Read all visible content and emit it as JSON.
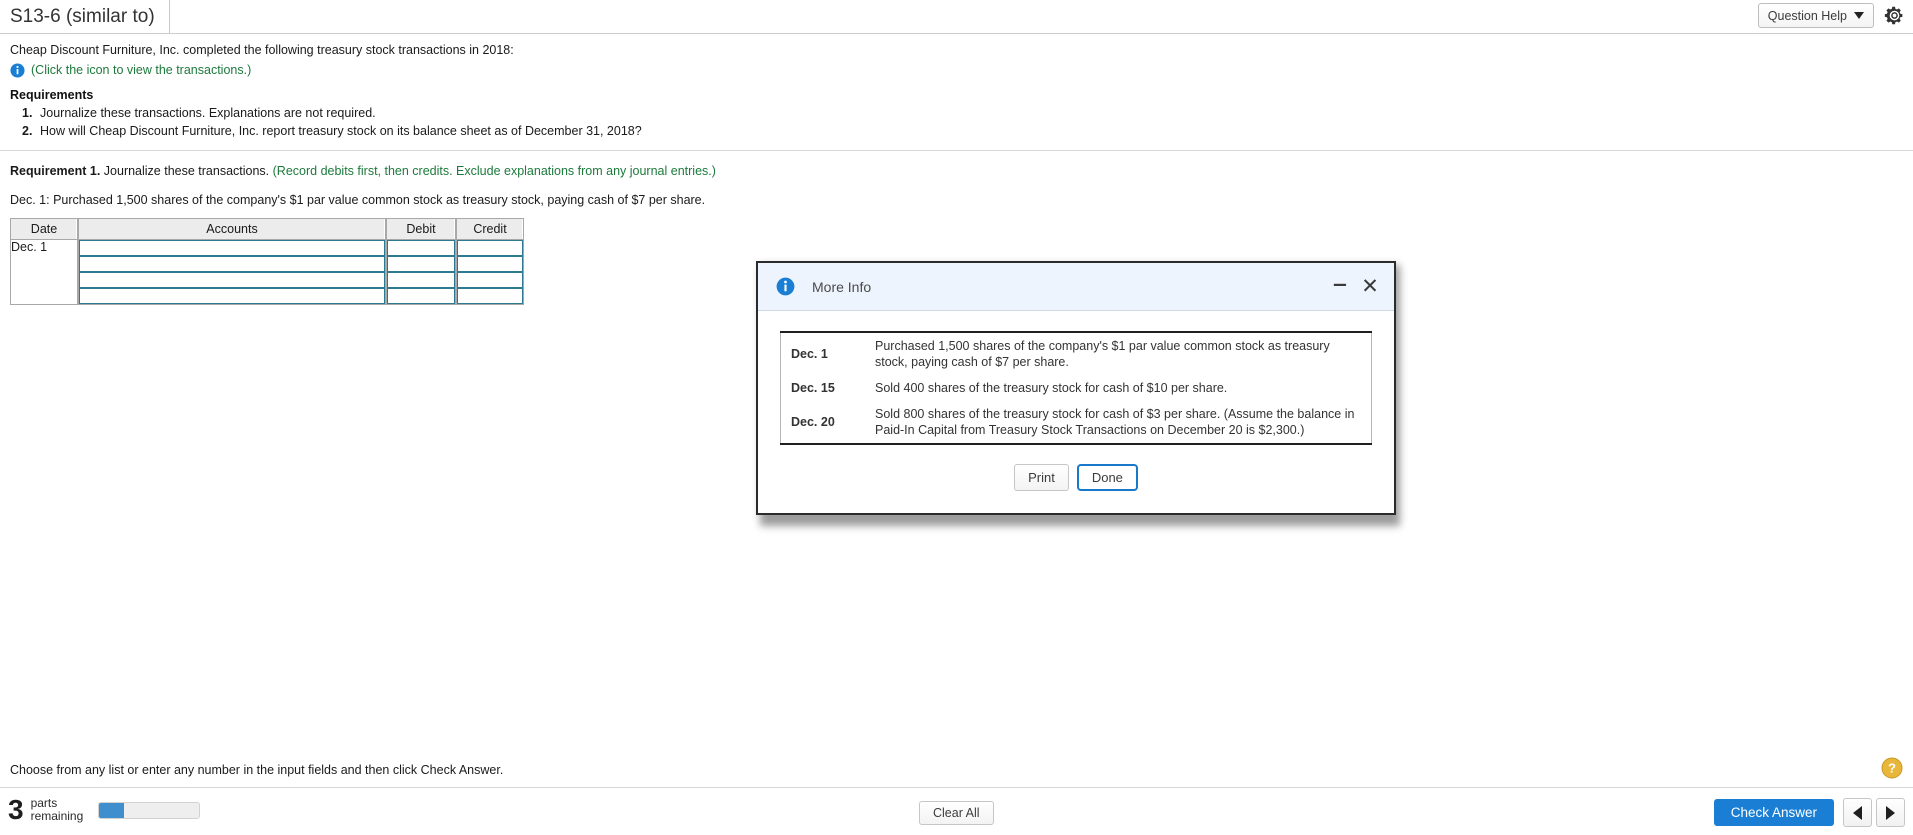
{
  "topbar": {
    "question_tab": "S13-6 (similar to)",
    "question_help_label": "Question Help",
    "gear_icon": "gear-icon",
    "caret_icon": "chevron-down-icon"
  },
  "prompt": {
    "intro": "Cheap Discount Furniture, Inc. completed the following treasury stock transactions in 2018:",
    "info_icon": "info-icon",
    "icon_link": "(Click the icon to view the transactions.)",
    "requirements_heading": "Requirements",
    "requirements": [
      {
        "num": "1.",
        "text": "Journalize these transactions. Explanations are not required."
      },
      {
        "num": "2.",
        "text": "How will Cheap Discount Furniture, Inc. report treasury stock on its balance sheet as of December 31, 2018?"
      }
    ]
  },
  "requirement1": {
    "label": "Requirement 1.",
    "text": " Journalize these transactions. ",
    "hint": "(Record debits first, then credits. Exclude explanations from any journal entries.)",
    "dec_line": "Dec. 1: Purchased 1,500 shares of the company's $1 par value common stock as treasury stock, paying cash of $7 per share."
  },
  "journal": {
    "columns": [
      "Date",
      "Accounts",
      "Debit",
      "Credit"
    ],
    "date_value": "Dec. 1",
    "rows": [
      {
        "accounts": "",
        "debit": "",
        "credit": ""
      },
      {
        "accounts": "",
        "debit": "",
        "credit": ""
      },
      {
        "accounts": "",
        "debit": "",
        "credit": ""
      },
      {
        "accounts": "",
        "debit": "",
        "credit": ""
      }
    ]
  },
  "modal": {
    "title": "More Info",
    "title_icon": "info-icon",
    "minimize_icon": "minimize-icon",
    "close_icon": "close-icon",
    "transactions": [
      {
        "date": "Dec. 1",
        "description": "Purchased 1,500 shares of the company's $1 par value common stock as treasury stock, paying cash of $7 per share."
      },
      {
        "date": "Dec. 15",
        "description": "Sold 400 shares of the treasury stock for cash of $10 per share."
      },
      {
        "date": "Dec. 20",
        "description": "Sold 800 shares of the treasury stock for cash of $3 per share. (Assume the balance in Paid-In Capital from Treasury Stock Transactions on December 20 is $2,300.)"
      }
    ],
    "print_label": "Print",
    "done_label": "Done"
  },
  "footer": {
    "note": "Choose from any list or enter any number in the input fields and then click Check Answer.",
    "help_circle_icon": "question-mark-icon",
    "parts_number": "3",
    "parts_word_line1": "parts",
    "parts_word_line2": "remaining",
    "progress_percent": 25,
    "clear_all_label": "Clear All",
    "check_answer_label": "Check Answer",
    "prev_icon": "arrow-left-icon",
    "next_icon": "arrow-right-icon"
  },
  "colors": {
    "accent_blue": "#1a7fd4",
    "link_green": "#1d7a3c",
    "input_border": "#2b7a8f",
    "modal_title_bg": "#eef4fd",
    "progress_fill": "#3f8fce",
    "help_yellow": "#e8b63a"
  }
}
